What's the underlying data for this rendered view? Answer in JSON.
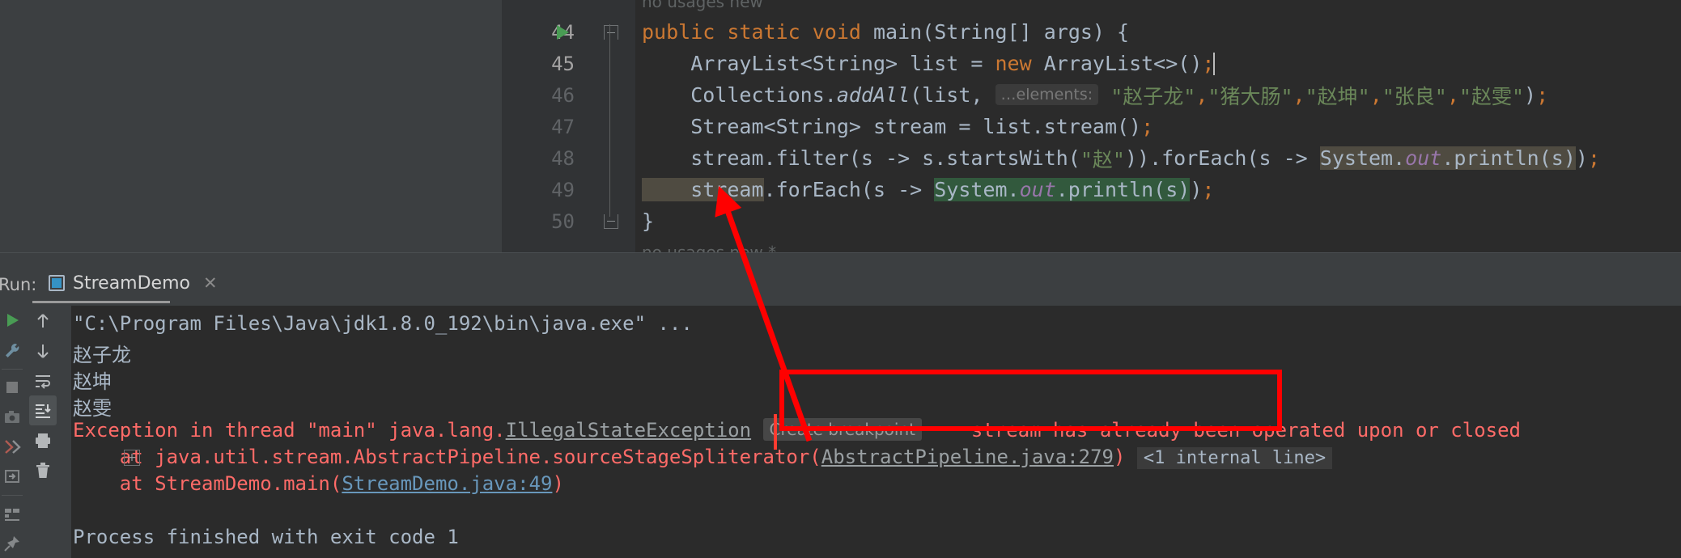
{
  "editor": {
    "usage_hint_top": "no usages   new",
    "usage_hint_bottom": "no usages   new *",
    "lines": [
      {
        "num": "44",
        "active": true,
        "has_run_marker": true,
        "fold": "up",
        "segments": [
          {
            "t": "public ",
            "c": "kw"
          },
          {
            "t": "static ",
            "c": "kw"
          },
          {
            "t": "void ",
            "c": "kw"
          },
          {
            "t": "main",
            "c": "fn"
          },
          {
            "t": "(String[] args) {",
            "c": "plain"
          }
        ]
      },
      {
        "num": "45",
        "active": true,
        "segments": [
          {
            "t": "    ArrayList<String> list = ",
            "c": "plain"
          },
          {
            "t": "new ",
            "c": "kw"
          },
          {
            "t": "ArrayList<>()",
            "c": "plain"
          },
          {
            "t": ";",
            "c": "semi"
          }
        ]
      },
      {
        "num": "46",
        "active": false,
        "segments": [
          {
            "t": "    Collections.",
            "c": "plain"
          },
          {
            "t": "addAll",
            "c": "ital"
          },
          {
            "t": "(list,",
            "c": "plain"
          },
          {
            "t": " ",
            "c": "plain"
          },
          {
            "t": "…elements:",
            "c": "hintbox"
          },
          {
            "t": " ",
            "c": "plain"
          },
          {
            "t": "\"赵子龙\"",
            "c": "str"
          },
          {
            "t": ",",
            "c": "semi"
          },
          {
            "t": "\"猪大肠\"",
            "c": "str"
          },
          {
            "t": ",",
            "c": "semi"
          },
          {
            "t": "\"赵坤\"",
            "c": "str"
          },
          {
            "t": ",",
            "c": "semi"
          },
          {
            "t": "\"张良\"",
            "c": "str"
          },
          {
            "t": ",",
            "c": "semi"
          },
          {
            "t": "\"赵雯\"",
            "c": "str"
          },
          {
            "t": ")",
            "c": "plain"
          },
          {
            "t": ";",
            "c": "semi"
          }
        ]
      },
      {
        "num": "47",
        "active": false,
        "segments": [
          {
            "t": "    Stream<String> stream = list.stream()",
            "c": "plain"
          },
          {
            "t": ";",
            "c": "semi"
          }
        ]
      },
      {
        "num": "48",
        "active": false,
        "segments": [
          {
            "t": "    stream.filter(s -> s.startsWith(",
            "c": "plain"
          },
          {
            "t": "\"赵\"",
            "c": "str"
          },
          {
            "t": ")).forEach(s -> ",
            "c": "plain"
          },
          {
            "t": "System.",
            "c": "plain",
            "hl": "hl-olive"
          },
          {
            "t": "out",
            "c": "static-it",
            "hl": "hl-olive"
          },
          {
            "t": ".println(s)",
            "c": "plain",
            "hl": "hl-olive"
          },
          {
            "t": ")",
            "c": "plain"
          },
          {
            "t": ";",
            "c": "semi"
          }
        ]
      },
      {
        "num": "49",
        "active": false,
        "segments": [
          {
            "t": "    stream",
            "c": "plain",
            "hl": "hl-olive"
          },
          {
            "t": ".forEach(s -> ",
            "c": "plain"
          },
          {
            "t": "System.",
            "c": "plain",
            "hl": "hl-green"
          },
          {
            "t": "out",
            "c": "static-it",
            "hl": "hl-green"
          },
          {
            "t": ".println(s)",
            "c": "plain",
            "hl": "hl-green"
          },
          {
            "t": ")",
            "c": "plain"
          },
          {
            "t": ";",
            "c": "semi"
          }
        ]
      },
      {
        "num": "50",
        "active": false,
        "fold": "dn",
        "segments": [
          {
            "t": "}",
            "c": "plain"
          }
        ]
      }
    ]
  },
  "run_panel": {
    "run_label": "Run:",
    "tab_name": "StreamDemo",
    "tab_close": "✕",
    "toolbar_left": [
      {
        "name": "rerun-icon",
        "glyph": "▶"
      },
      {
        "name": "settings-wrench-icon",
        "glyph": "🔧"
      },
      {
        "name": "stop-icon",
        "glyph": "■"
      },
      {
        "name": "camera-icon",
        "glyph": "📷"
      },
      {
        "name": "stop-process-icon",
        "glyph": "✖"
      },
      {
        "name": "export-icon",
        "glyph": "→"
      },
      {
        "name": "layout-icon",
        "glyph": "▤"
      },
      {
        "name": "pin-icon",
        "glyph": "📌"
      }
    ],
    "toolbar_mid": [
      {
        "name": "up-arrow-icon",
        "glyph": "↑"
      },
      {
        "name": "down-arrow-icon",
        "glyph": "↓"
      },
      {
        "name": "soft-wrap-icon",
        "glyph": "⏎"
      },
      {
        "name": "scroll-to-end-icon",
        "glyph": "⤓",
        "selected": true
      },
      {
        "name": "print-icon",
        "glyph": "🖨"
      },
      {
        "name": "clear-all-icon",
        "glyph": "🗑"
      }
    ],
    "console": {
      "command_line": "\"C:\\Program Files\\Java\\jdk1.8.0_192\\bin\\java.exe\" ...",
      "outputs": [
        "赵子龙",
        "赵坤",
        "赵雯"
      ],
      "exception": {
        "prefix": "Exception in thread ",
        "thread": "\"main\"",
        "package": " java.lang.",
        "type": "IllegalStateException",
        "breakpoint_label": "Create breakpoint",
        "message": "stream has already been operated upon or closed"
      },
      "stack": [
        {
          "text": "    at java.util.stream.AbstractPipeline.sourceStageSpliterator(",
          "link": "AbstractPipeline.java:279",
          "suffix": ")",
          "fold": "<1 internal line>",
          "expandable": true
        },
        {
          "text": "    at StreamDemo.main(",
          "link": "StreamDemo.java:49",
          "suffix": ")",
          "link_blue": true
        }
      ],
      "exit_line": "Process finished with exit code 1"
    }
  },
  "annotations": {
    "arrow_color": "#ff0000",
    "box_color": "#ff0000",
    "highlight_text": "stream has already been operated upon or closed"
  },
  "colors": {
    "editor_bg": "#2b2b2b",
    "panel_bg": "#3c3f41",
    "gutter_bg": "#313335",
    "keyword": "#cc7832",
    "string": "#6a8759",
    "text": "#a9b7c6",
    "error": "#ff6b68",
    "link": "#6897bb",
    "run_green": "#499c54"
  }
}
